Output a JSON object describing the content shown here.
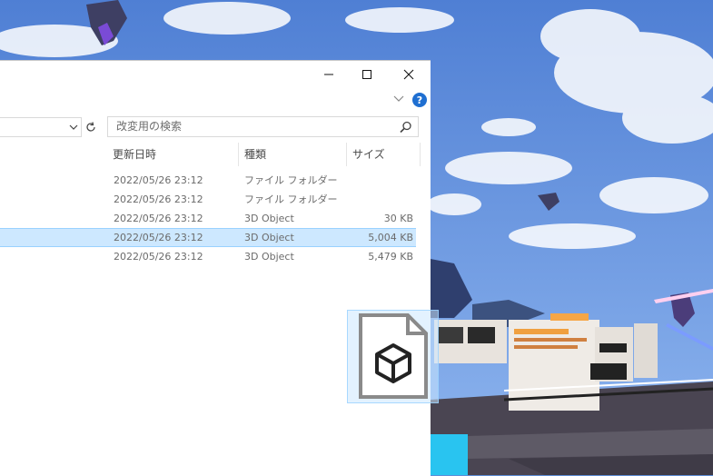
{
  "window": {
    "search_placeholder": "改変用の検索",
    "help_label": "?",
    "columns": {
      "modified": "更新日時",
      "type": "種類",
      "size": "サイズ"
    },
    "rows": [
      {
        "modified": "2022/05/26 23:12",
        "type": "ファイル フォルダー",
        "size": ""
      },
      {
        "modified": "2022/05/26 23:12",
        "type": "ファイル フォルダー",
        "size": ""
      },
      {
        "modified": "2022/05/26 23:12",
        "type": "3D Object",
        "size": "30 KB"
      },
      {
        "modified": "2022/05/26 23:12",
        "type": "3D Object",
        "size": "5,004 KB"
      },
      {
        "modified": "2022/05/26 23:12",
        "type": "3D Object",
        "size": "5,479 KB"
      }
    ]
  },
  "colors": {
    "selection": "#cde8ff",
    "selection_border": "#99d1ff",
    "help_blue": "#1f6fd1"
  },
  "icons": [
    "minimize-icon",
    "maximize-icon",
    "close-icon",
    "chevron-down-icon",
    "help-icon",
    "refresh-icon",
    "search-icon",
    "3d-object-file-icon"
  ]
}
